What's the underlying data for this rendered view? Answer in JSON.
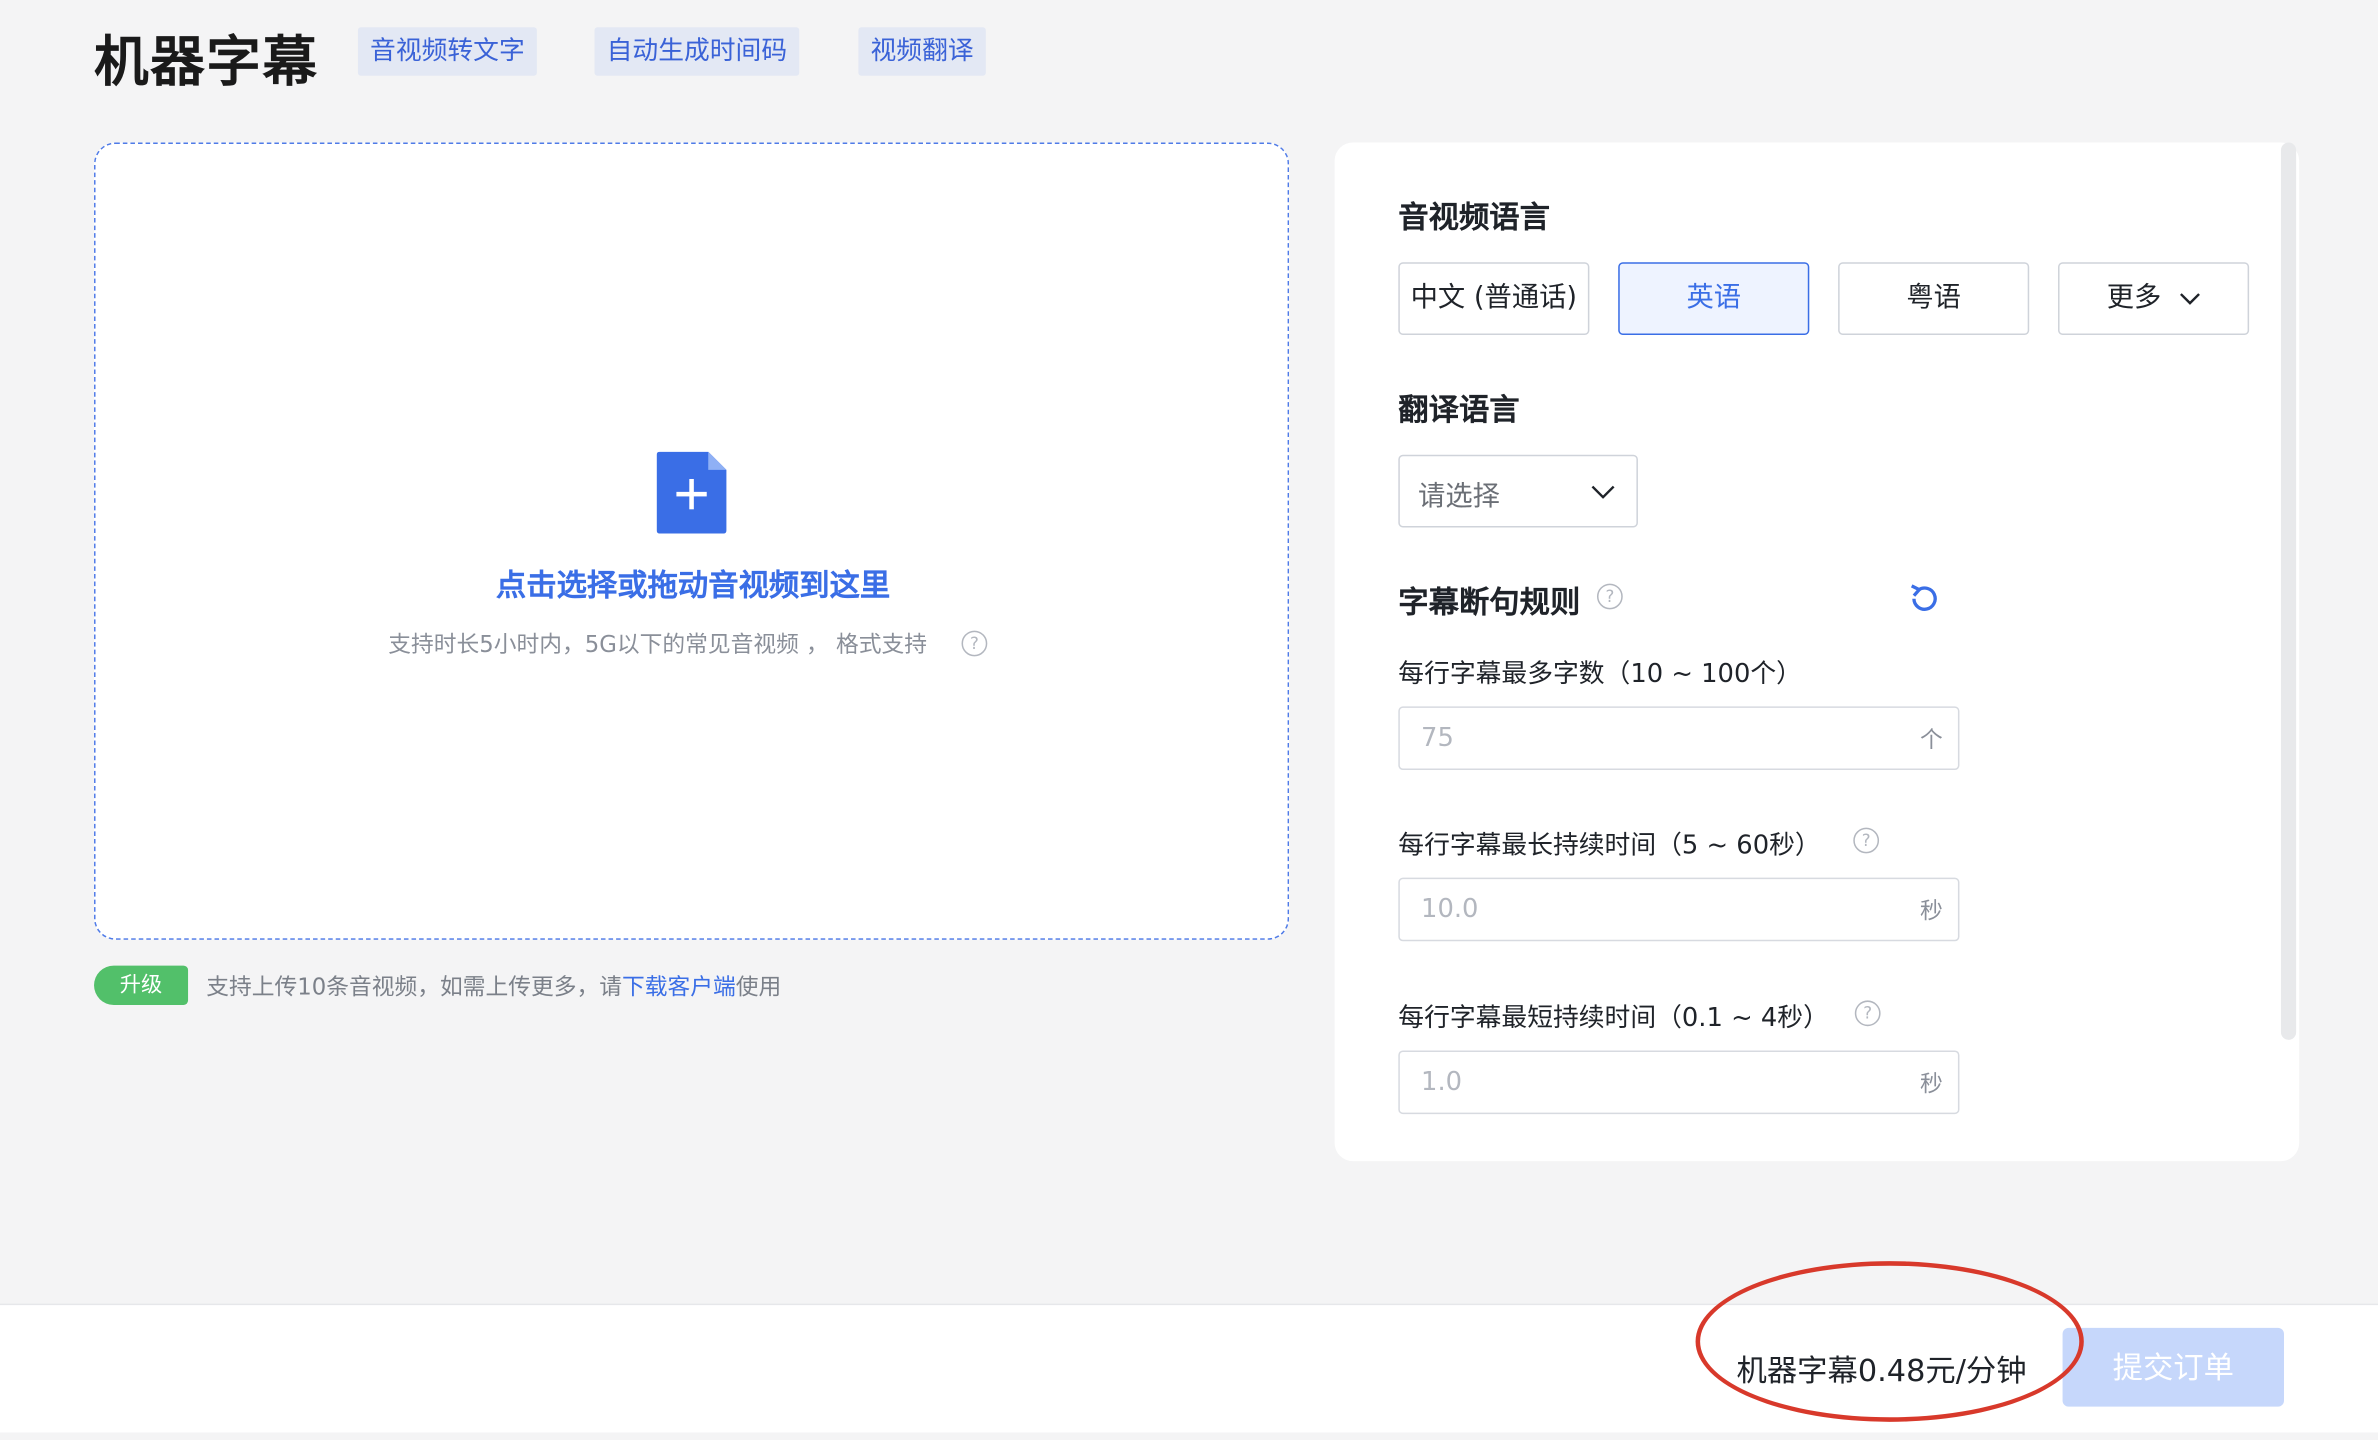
{
  "header": {
    "title": "机器字幕",
    "tags": [
      "音视频转文字",
      "自动生成时间码",
      "视频翻译"
    ]
  },
  "upload": {
    "prompt": "点击选择或拖动音视频到这里",
    "hint": "支持时长5小时内，5G以下的常见音视频 ， 格式支持",
    "badge": "升级",
    "note_prefix": "支持上传10条音视频，如需上传更多，请",
    "note_link": "下载客户端",
    "note_suffix": "使用"
  },
  "settings": {
    "audio_language_title": "音视频语言",
    "languages": [
      "中文 (普通话)",
      "英语",
      "粤语",
      "更多"
    ],
    "selected_language": "英语",
    "translation_title": "翻译语言",
    "translation_placeholder": "请选择",
    "rules_title": "字幕断句规则",
    "fields": [
      {
        "label": "每行字幕最多字数（10 ~ 100个）",
        "value": "75",
        "suffix": "个"
      },
      {
        "label": "每行字幕最长持续时间（5 ~ 60秒）",
        "value": "10.0",
        "suffix": "秒"
      },
      {
        "label": "每行字幕最短持续时间（0.1 ~ 4秒）",
        "value": "1.0",
        "suffix": "秒"
      }
    ]
  },
  "footer": {
    "price": "机器字幕0.48元/分钟",
    "submit": "提交订单"
  },
  "colors": {
    "accent": "#3a6ee6",
    "upgrade_badge": "#52c06a",
    "annotation_ellipse": "#d8392b",
    "submit_disabled": "#c6d7fb"
  }
}
